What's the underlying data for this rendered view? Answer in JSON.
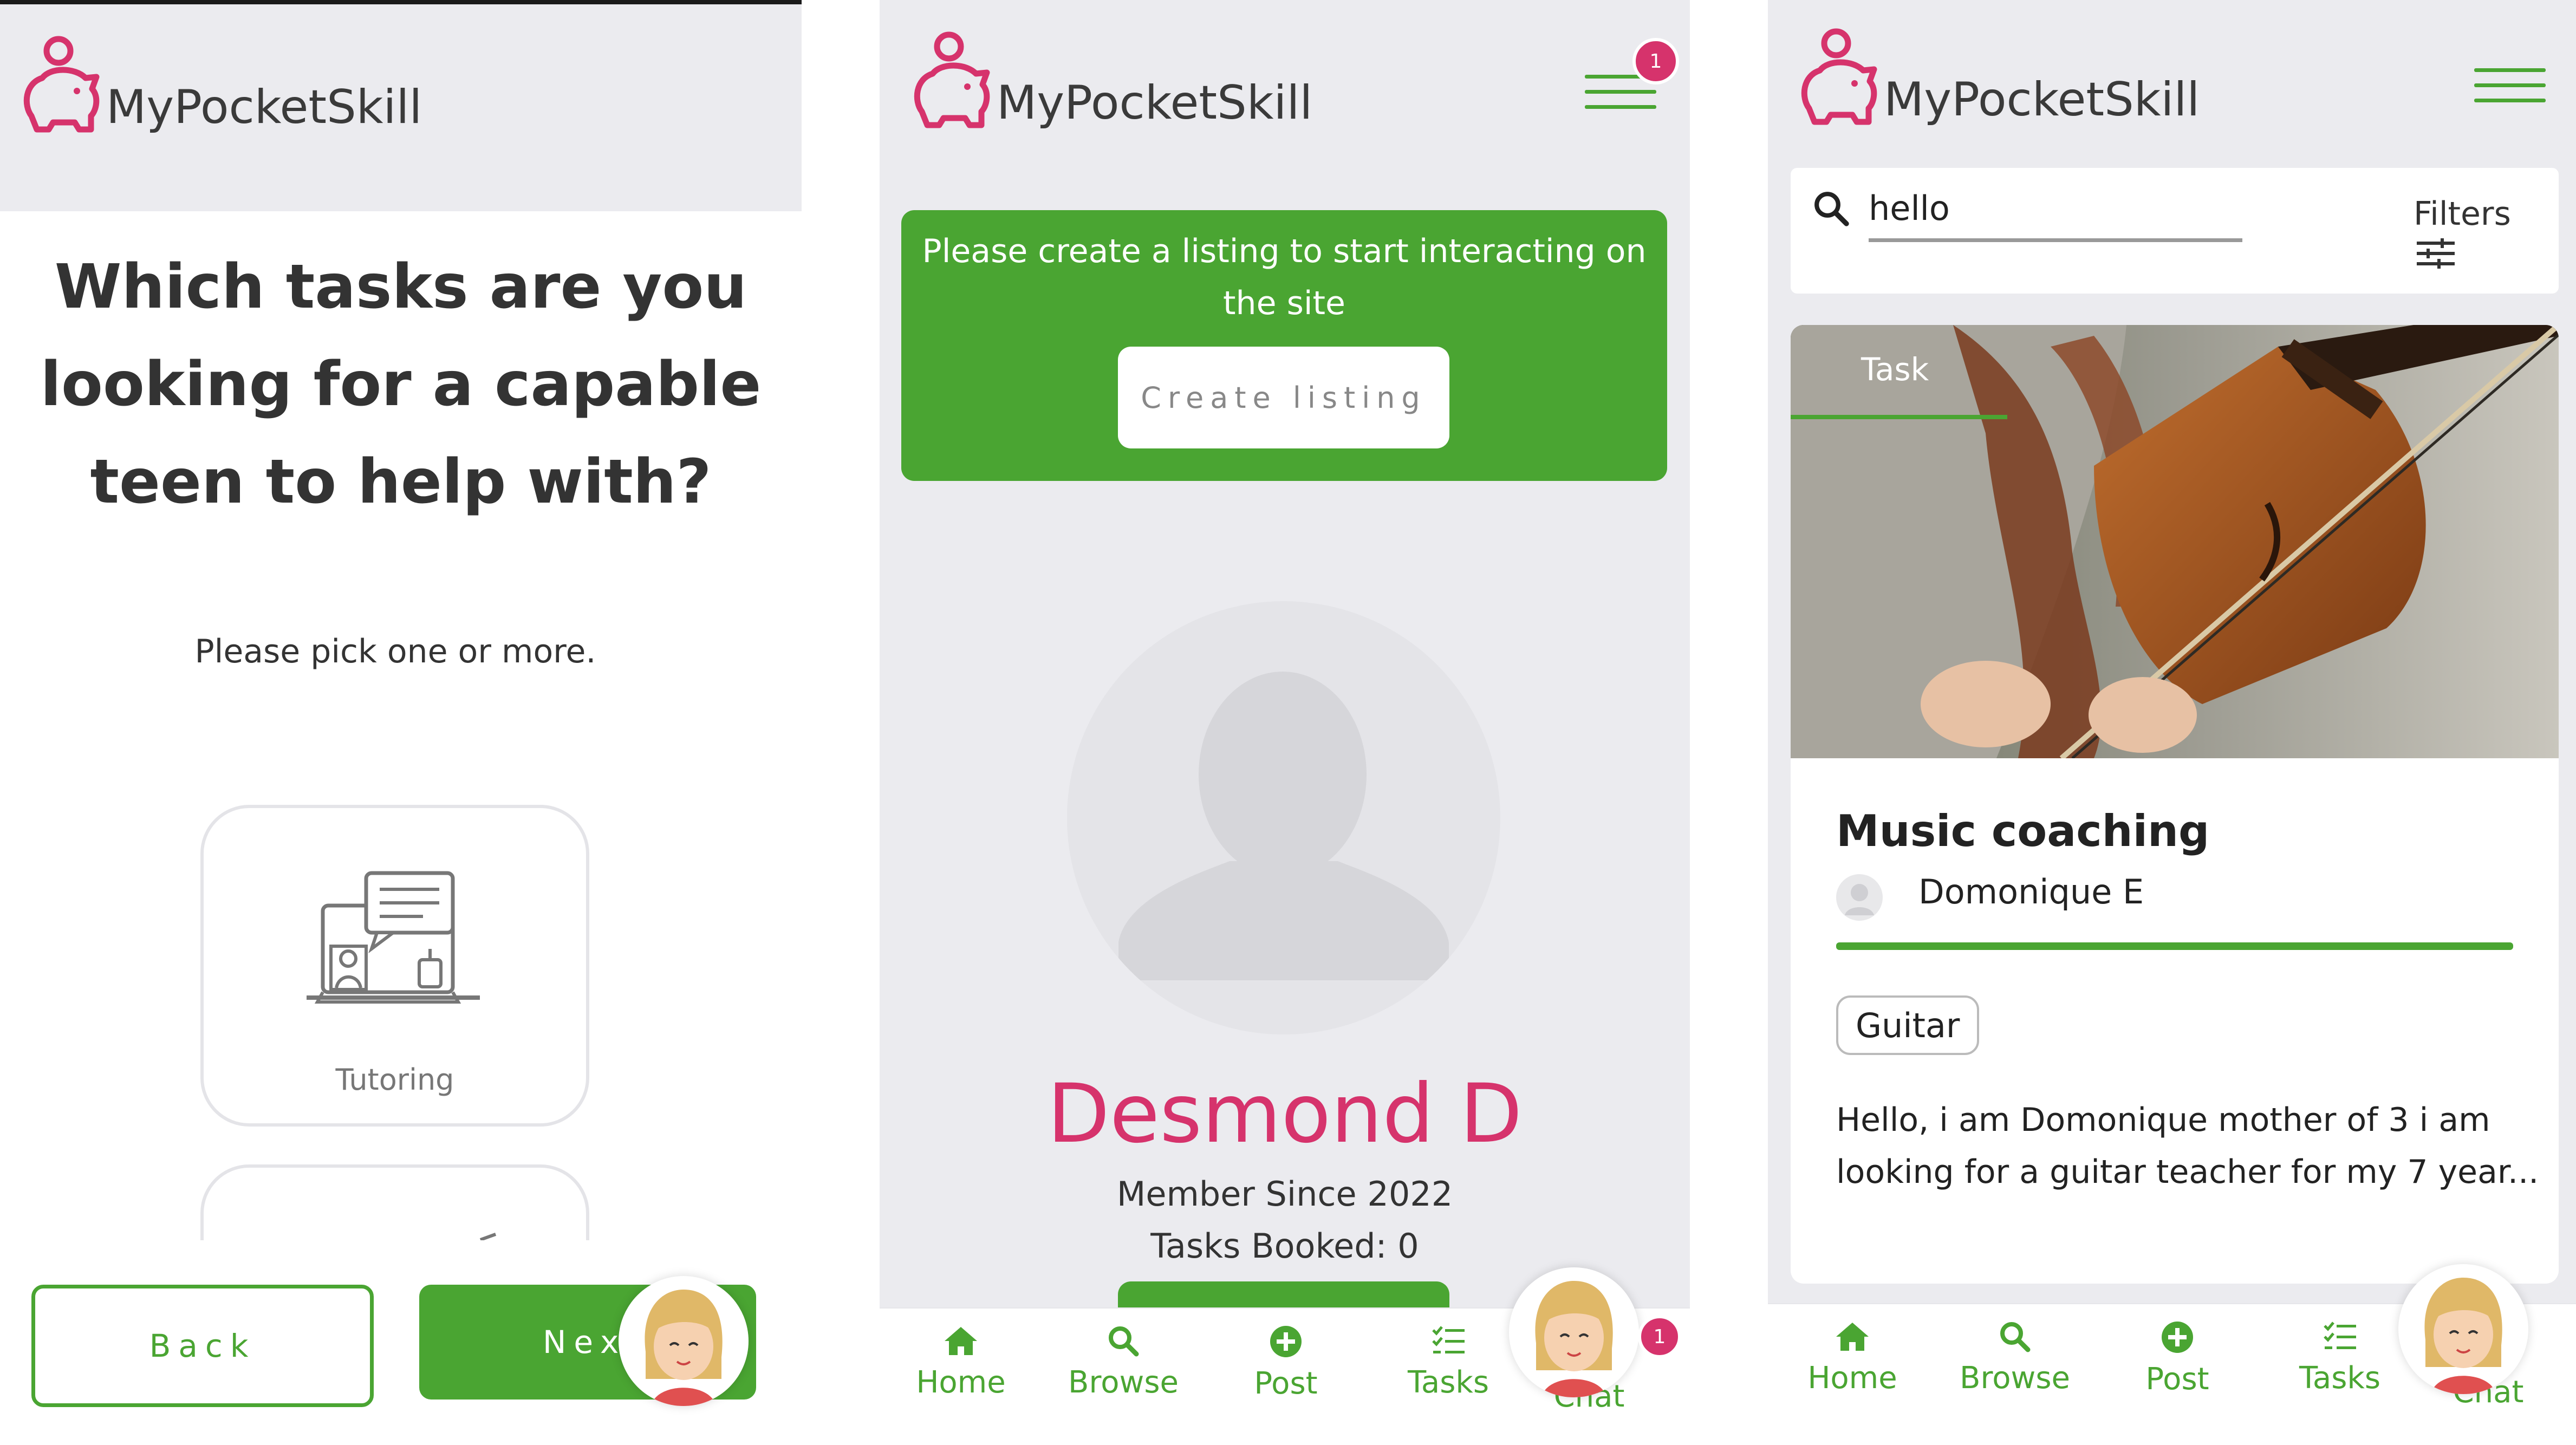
{
  "brand": {
    "name": "MyPocketSkill",
    "accent_green": "#4aa532",
    "accent_pink": "#d6336c"
  },
  "onboarding": {
    "question": "Which tasks are you looking for a capable teen to help with?",
    "question_lines": [
      "Which tasks are you",
      "looking for a capable",
      "teen to help with?"
    ],
    "hint": "Please pick one or more.",
    "card_label": "Tutoring",
    "card_icon": "online-tutoring-icon",
    "back_label": "Back",
    "next_label": "Next"
  },
  "profile": {
    "notification_count": "1",
    "banner_text_line1": "Please create a listing to start interacting on",
    "banner_text_line2": "the site",
    "create_listing_label": "Create listing",
    "user_name": "Desmond D",
    "member_since": "Member Since 2022",
    "tasks_booked_label": "Tasks Booked:",
    "tasks_booked_value": "0",
    "chat_badge": "1"
  },
  "browse": {
    "search_value": "hello",
    "filters_label": "Filters",
    "card_tag": "Task",
    "card_title": "Music coaching",
    "author": "Domonique E",
    "skill_chip": "Guitar",
    "description_line1": "Hello, i am Domonique mother of 3 i am",
    "description_line2": "looking for a guitar teacher for my 7 year..."
  },
  "nav": {
    "items": [
      {
        "label": "Home",
        "icon": "home-icon"
      },
      {
        "label": "Browse",
        "icon": "search-icon"
      },
      {
        "label": "Post",
        "icon": "plus-circle-icon"
      },
      {
        "label": "Tasks",
        "icon": "checklist-icon"
      },
      {
        "label": "Chat",
        "icon": "chat-avatar-icon"
      }
    ]
  }
}
